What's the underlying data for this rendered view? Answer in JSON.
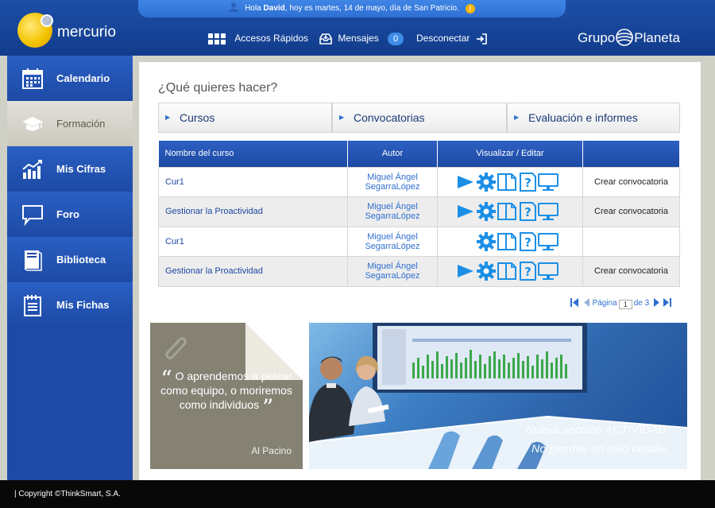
{
  "header": {
    "greeting_prefix": "Hola ",
    "greeting_user": "David",
    "greeting_suffix": ", hoy es martes, 14 de mayo, día de San Patricio.",
    "logo_text": "mercurio",
    "brand_left": "Grupo",
    "brand_right": "Planeta",
    "nav": {
      "accesos": "Accesos Rápidos",
      "mensajes": "Mensajes",
      "mensajes_count": "0",
      "desconectar": "Desconectar"
    }
  },
  "sidebar": {
    "items": [
      {
        "label": "Calendario",
        "icon": "calendar-icon",
        "active": false
      },
      {
        "label": "Formación",
        "icon": "graduation-cap-icon",
        "active": true
      },
      {
        "label": "Mis Cifras",
        "icon": "chart-icon",
        "active": false
      },
      {
        "label": "Foro",
        "icon": "speech-bubble-icon",
        "active": false
      },
      {
        "label": "Biblioteca",
        "icon": "book-icon",
        "active": false
      },
      {
        "label": "Mis Fichas",
        "icon": "notepad-icon",
        "active": false
      }
    ]
  },
  "main": {
    "question": "¿Qué quieres hacer?",
    "tabs": [
      {
        "label": "Cursos"
      },
      {
        "label": "Convocatorias"
      },
      {
        "label": "Evaluación e informes"
      }
    ],
    "table": {
      "headers": [
        "Nombre del curso",
        "Autor",
        "Visualizar / Editar",
        ""
      ],
      "rows": [
        {
          "name": "Cur1",
          "author_line1": "Miguel Ángel",
          "author_line2": "SegarraLópez",
          "has_play": true,
          "action": "Crear convocatoria"
        },
        {
          "name": "Gestionar la Proactividad",
          "author_line1": "Miguel Ángel",
          "author_line2": "SegarraLópez",
          "has_play": true,
          "action": "Crear convocatoria"
        },
        {
          "name": "Cur1",
          "author_line1": "Miguel Ángel",
          "author_line2": "SegarraLópez",
          "has_play": false,
          "action": ""
        },
        {
          "name": "Gestionar la Proactividad",
          "author_line1": "Miguel Ángel",
          "author_line2": "SegarraLópez",
          "has_play": true,
          "action": "Crear convocatoria"
        }
      ]
    },
    "pager": {
      "page_label": "Página",
      "current": "1",
      "of_label": "de 3"
    },
    "quote": {
      "open": "“",
      "text": "O aprendemos a pelear como equipo, o moriremos como individuos",
      "close": "”",
      "author": "Al Pacino"
    },
    "banner": {
      "line1": "Nueva sección ACTIVIDAD.",
      "line2": "No pierdas un solo detalle."
    }
  },
  "footer": {
    "text": "|  Copyright ©ThinkSmart, S.A."
  },
  "colors": {
    "header_blue": "#1c4fa8",
    "sidebar_blue": "#1f49a6",
    "icon_blue": "#1b8fe6",
    "active_item": "#d8d5cc"
  }
}
